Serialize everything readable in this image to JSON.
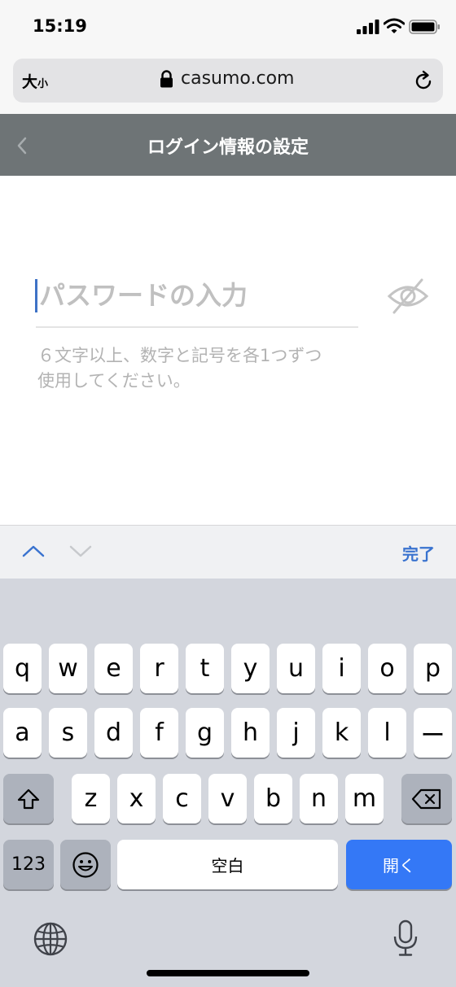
{
  "status_bar": {
    "time": "15:19"
  },
  "browser": {
    "text_size_label": "大",
    "text_size_small": "小",
    "url": "casumo.com"
  },
  "header": {
    "title": "ログイン情報の設定"
  },
  "form": {
    "password_placeholder": "パスワードの入力",
    "password_value": "",
    "hint_line1": "６文字以上、数字と記号を各1つずつ",
    "hint_line2": "使用してください。"
  },
  "accessory": {
    "done_label": "完了"
  },
  "keyboard": {
    "row1": [
      "q",
      "w",
      "e",
      "r",
      "t",
      "y",
      "u",
      "i",
      "o",
      "p"
    ],
    "row2": [
      "a",
      "s",
      "d",
      "f",
      "g",
      "h",
      "j",
      "k",
      "l",
      "ー"
    ],
    "row3": [
      "z",
      "x",
      "c",
      "v",
      "b",
      "n",
      "m"
    ],
    "numbers_label": "123",
    "space_label": "空白",
    "return_label": "開く"
  },
  "colors": {
    "accent": "#3a73cf",
    "header_bg": "#6e7476",
    "return_key": "#3478f6"
  },
  "icons": [
    "signal-icon",
    "wifi-icon",
    "battery-icon",
    "lock-icon",
    "reload-icon",
    "back-icon",
    "eye-off-icon",
    "chevron-up-icon",
    "chevron-down-icon",
    "shift-icon",
    "delete-icon",
    "emoji-icon",
    "globe-icon",
    "mic-icon"
  ]
}
